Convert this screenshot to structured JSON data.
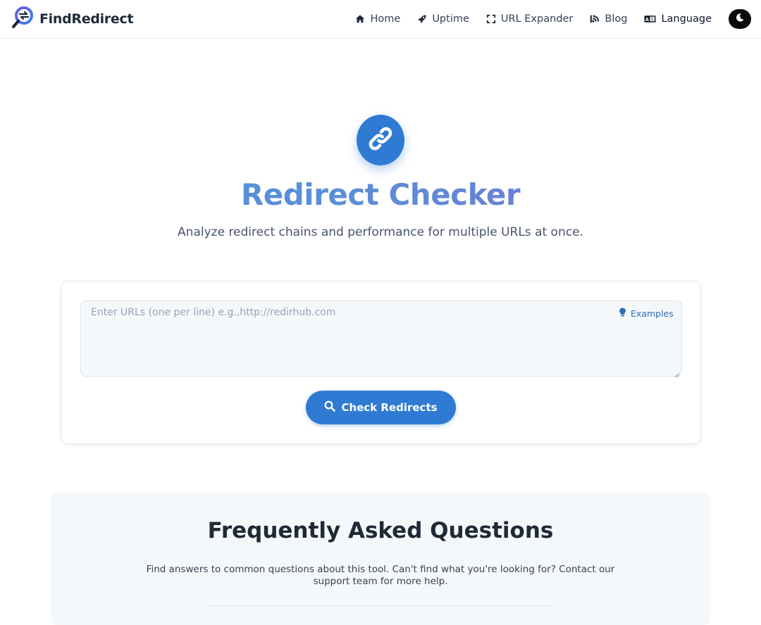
{
  "brand": {
    "name": "FindRedirect",
    "accent": "#2f7bd3",
    "logo_icon": "magnifier-redirect-logo"
  },
  "nav": {
    "items": [
      {
        "label": "Home",
        "icon": "home-icon"
      },
      {
        "label": "Uptime",
        "icon": "rocket-icon"
      },
      {
        "label": "URL Expander",
        "icon": "expand-icon"
      },
      {
        "label": "Blog",
        "icon": "blog-icon"
      },
      {
        "label": "Language",
        "icon": "language-icon"
      }
    ],
    "theme_toggle_icon": "moon-icon"
  },
  "hero": {
    "icon": "link-icon",
    "title": "Redirect Checker",
    "subtitle": "Analyze redirect chains and performance for multiple URLs at once."
  },
  "checker": {
    "placeholder": "Enter URLs (one per line) e.g.,http://redirhub.com",
    "value": "",
    "examples_label": "Examples",
    "examples_icon": "lightbulb-icon",
    "button_label": "Check Redirects",
    "button_icon": "search-icon"
  },
  "faq": {
    "title": "Frequently Asked Questions",
    "description": "Find answers to common questions about this tool. Can't find what you're looking for? Contact our support team for more help."
  }
}
